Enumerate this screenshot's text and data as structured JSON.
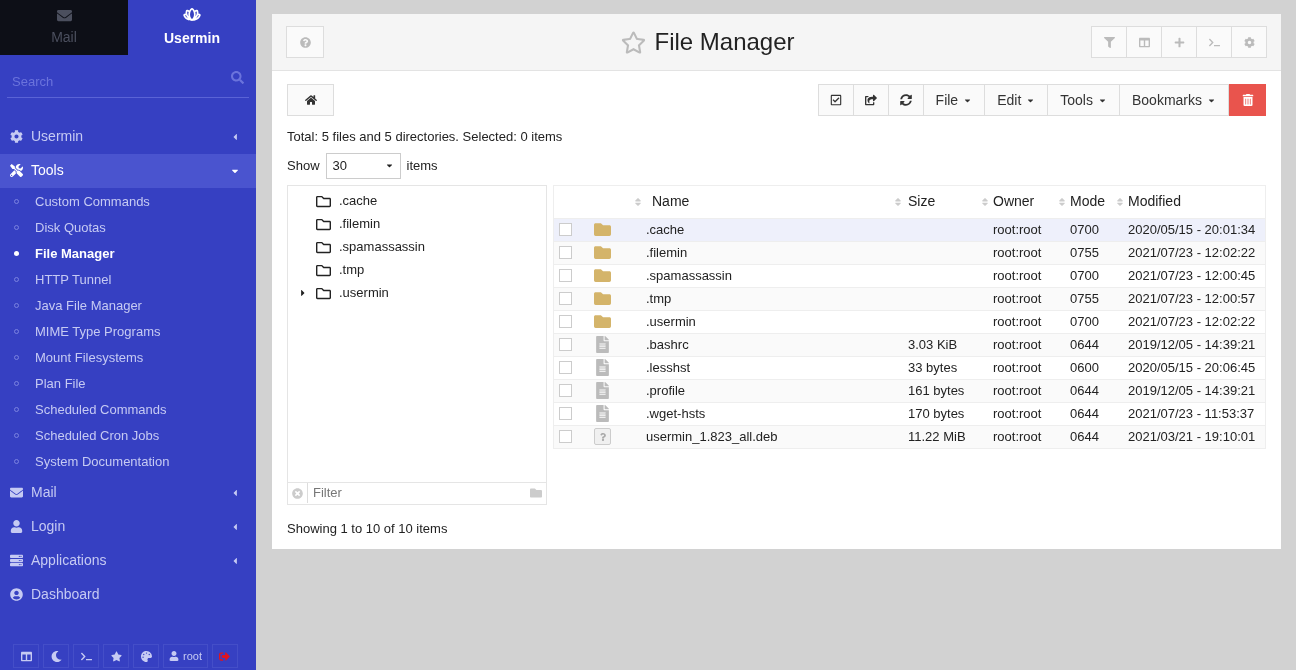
{
  "sidebar": {
    "tabs": [
      {
        "label": "Mail",
        "selected": false
      },
      {
        "label": "Usermin",
        "selected": true
      }
    ],
    "search": {
      "placeholder": "Search"
    },
    "menu": [
      {
        "label": "Usermin",
        "kind": "settings",
        "expanded": false
      },
      {
        "label": "Tools",
        "kind": "tools",
        "expanded": true,
        "children": [
          {
            "label": "Custom Commands",
            "selected": false
          },
          {
            "label": "Disk Quotas",
            "selected": false
          },
          {
            "label": "File Manager",
            "selected": true
          },
          {
            "label": "HTTP Tunnel",
            "selected": false
          },
          {
            "label": "Java File Manager",
            "selected": false
          },
          {
            "label": "MIME Type Programs",
            "selected": false
          },
          {
            "label": "Mount Filesystems",
            "selected": false
          },
          {
            "label": "Plan File",
            "selected": false
          },
          {
            "label": "Scheduled Commands",
            "selected": false
          },
          {
            "label": "Scheduled Cron Jobs",
            "selected": false
          },
          {
            "label": "System Documentation",
            "selected": false
          }
        ]
      },
      {
        "label": "Mail",
        "kind": "mail",
        "expanded": false
      },
      {
        "label": "Login",
        "kind": "login",
        "expanded": false
      },
      {
        "label": "Applications",
        "kind": "apps",
        "expanded": false
      },
      {
        "label": "Dashboard",
        "kind": "dashboard"
      }
    ],
    "footer": {
      "user": "root"
    }
  },
  "page": {
    "title": "File Manager",
    "menus": [
      "File",
      "Edit",
      "Tools",
      "Bookmarks"
    ],
    "summary": "Total: 5 files and 5 directories. Selected: 0 items",
    "show": {
      "label": "Show",
      "value": "30",
      "suffix": "items"
    },
    "tree": [
      {
        "label": ".cache",
        "expandable": false
      },
      {
        "label": ".filemin",
        "expandable": false
      },
      {
        "label": ".spamassassin",
        "expandable": false
      },
      {
        "label": ".tmp",
        "expandable": false
      },
      {
        "label": ".usermin",
        "expandable": true
      }
    ],
    "tree_filter": {
      "placeholder": "Filter"
    },
    "table": {
      "columns": [
        "Name",
        "Size",
        "Owner",
        "Mode",
        "Modified"
      ],
      "rows": [
        {
          "kind": "folder",
          "selected": true,
          "checked": false,
          "name": ".cache",
          "owner": "root:root",
          "mode": "0700",
          "modified": "2020/05/15 - 20:01:34"
        },
        {
          "kind": "folder",
          "selected": false,
          "checked": false,
          "name": ".filemin",
          "owner": "root:root",
          "mode": "0755",
          "modified": "2021/07/23 - 12:02:22"
        },
        {
          "kind": "folder",
          "selected": false,
          "checked": false,
          "name": ".spamassassin",
          "owner": "root:root",
          "mode": "0700",
          "modified": "2021/07/23 - 12:00:45"
        },
        {
          "kind": "folder",
          "selected": false,
          "checked": false,
          "name": ".tmp",
          "owner": "root:root",
          "mode": "0755",
          "modified": "2021/07/23 - 12:00:57"
        },
        {
          "kind": "folder",
          "selected": false,
          "checked": false,
          "name": ".usermin",
          "owner": "root:root",
          "mode": "0700",
          "modified": "2021/07/23 - 12:02:22"
        },
        {
          "kind": "text",
          "selected": false,
          "checked": false,
          "name": ".bashrc",
          "size": "3.03 KiB",
          "owner": "root:root",
          "mode": "0644",
          "modified": "2019/12/05 - 14:39:21"
        },
        {
          "kind": "text",
          "selected": false,
          "checked": false,
          "name": ".lesshst",
          "size": "33 bytes",
          "owner": "root:root",
          "mode": "0600",
          "modified": "2020/05/15 - 20:06:45"
        },
        {
          "kind": "text",
          "selected": false,
          "checked": false,
          "name": ".profile",
          "size": "161 bytes",
          "owner": "root:root",
          "mode": "0644",
          "modified": "2019/12/05 - 14:39:21"
        },
        {
          "kind": "text",
          "selected": false,
          "checked": false,
          "name": ".wget-hsts",
          "size": "170 bytes",
          "owner": "root:root",
          "mode": "0644",
          "modified": "2021/07/23 - 11:53:37"
        },
        {
          "kind": "unknown",
          "selected": false,
          "checked": false,
          "name": "usermin_1.823_all.deb",
          "size": "11.22 MiB",
          "owner": "root:root",
          "mode": "0644",
          "modified": "2021/03/21 - 19:10:01"
        }
      ]
    },
    "footer": "Showing 1 to 10 of 10 items"
  }
}
